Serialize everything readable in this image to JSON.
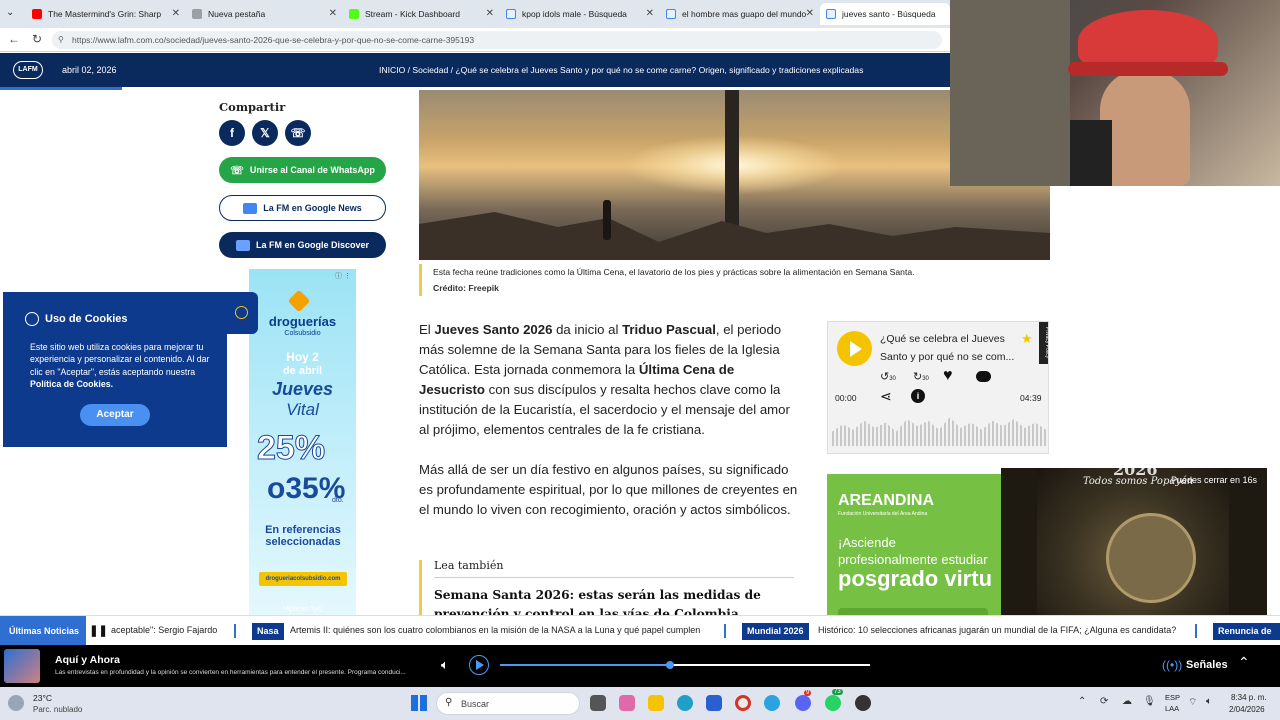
{
  "browser": {
    "tabs": [
      {
        "label": "The Mastermind's Grin: Sharp",
        "color": "#ff0000"
      },
      {
        "label": "Nueva pestaña",
        "color": "#5f6368"
      },
      {
        "label": "Stream - Kick Dashboard",
        "color": "#53fc18"
      },
      {
        "label": "kpop idols male - Búsqueda",
        "color": "#4285f4"
      },
      {
        "label": "el hombre mas guapo del mundo",
        "color": "#4285f4"
      },
      {
        "label": "jueves santo - Búsqueda",
        "color": "#4285f4"
      }
    ],
    "url": "https://www.lafm.com.co/sociedad/jueves-santo-2026-que-se-celebra-y-por-que-no-se-come-carne-395193"
  },
  "site": {
    "logo": "LAFM",
    "date": "abril 02, 2026",
    "breadcrumb": "INICIO  /  Sociedad  /  ¿Qué se celebra el Jueves Santo y por qué no se come carne? Origen, significado y tradiciones explicadas"
  },
  "share": {
    "title": "Compartir",
    "whatsapp_channel": "Unirse al Canal de WhatsApp",
    "google_news": "La FM en Google News",
    "google_discover": "La FM en Google Discover"
  },
  "image": {
    "caption": "Esta fecha reúne tradiciones como la Última Cena, el lavatorio de los pies y prácticas sobre la alimentación en Semana Santa.",
    "credit": "Crédito: Freepik"
  },
  "article": {
    "p1_a": "El ",
    "p1_b": "Jueves Santo 2026",
    "p1_c": " da inicio al ",
    "p1_d": "Triduo Pascual",
    "p1_e": ", el periodo más solemne de la Semana Santa para los fieles de la Iglesia Católica. Esta jornada conmemora la ",
    "p1_f": "Última Cena de Jesucristo",
    "p1_g": " con sus discípulos y resalta hechos clave como la institución de la Eucaristía, el sacerdocio y el mensaje del amor al prójimo, elementos centrales de la fe cristiana.",
    "p2": "Más allá de ser un día festivo en algunos países, su significado es profundamente espiritual, por lo que millones de creyentes en el mundo lo viven con recogimiento, oración y actos simbólicos.",
    "related_label": "Lea también",
    "related_title": "Semana Santa 2026: estas serán las medidas de prevención y control en las vías de Colombia"
  },
  "cookies": {
    "title": "Uso de Cookies",
    "text_a": "Este sitio web utiliza cookies para mejorar tu experiencia y personalizar el contenido. Al dar clic en \"Aceptar\", estás aceptando nuestra ",
    "text_b": "Política de Cookies.",
    "accept": "Aceptar"
  },
  "ad_left": {
    "brand": "droguerías",
    "brand_sub": "Colsubsidio",
    "l1": "Hoy 2",
    "l2": "de abril",
    "l3": "Jueves",
    "l4": "Vital",
    "pct1": "25%",
    "pct2": "o35%",
    "dto": "dto.",
    "refs": "En referencias seleccionadas",
    "url": "drogueriacolsubsidio.com",
    "fine": "*Aplican TyC"
  },
  "audio": {
    "title_line1": "¿Qué se celebra el Jueves",
    "title_line2": "Santo y por qué no se com...",
    "time_start": "00:00",
    "time_end": "04:39",
    "privacy": "Privacy Policy",
    "back": "30",
    "fwd": "30"
  },
  "ad_right": {
    "brand": "AREANDINA",
    "sub": "Fundación Universitaria del Área Andina",
    "l1": "¡Asciende",
    "l2": "profesionalmente estudiar",
    "l3": "posgrado virtu"
  },
  "video_ad": {
    "close": "Puedes cerrar en 16s",
    "year": "2026",
    "tagline": "Todos somos Popayán"
  },
  "ticker": {
    "label": "Últimas Noticias",
    "items": [
      {
        "tag": "",
        "text": "aceptable\": Sergio Fajardo"
      },
      {
        "tag": "Nasa",
        "text": "Artemis II: quiénes son los cuatro colombianos en la misión de la NASA a la Luna y qué papel cumplen"
      },
      {
        "tag": "Mundial 2026",
        "text": "Histórico: 10 selecciones africanas jugarán un mundial de la FIFA; ¿Alguna es candidata?"
      },
      {
        "tag": "Renuncia de",
        "text": ""
      }
    ]
  },
  "player": {
    "show": "Aquí y Ahora",
    "desc": "Las entrevistas en profundidad y la opinión se convierten en herramientas para entender el presente. Programa conduci...",
    "signals": "Señales",
    "progress": 0.46
  },
  "taskbar": {
    "temp": "23°C",
    "weather": "Parc. nublado",
    "search": "Buscar",
    "lang1": "ESP",
    "lang2": "LAA",
    "time": "8:34 p. m.",
    "date": "2/04/2026",
    "badge1": "73",
    "badge2": "9"
  }
}
